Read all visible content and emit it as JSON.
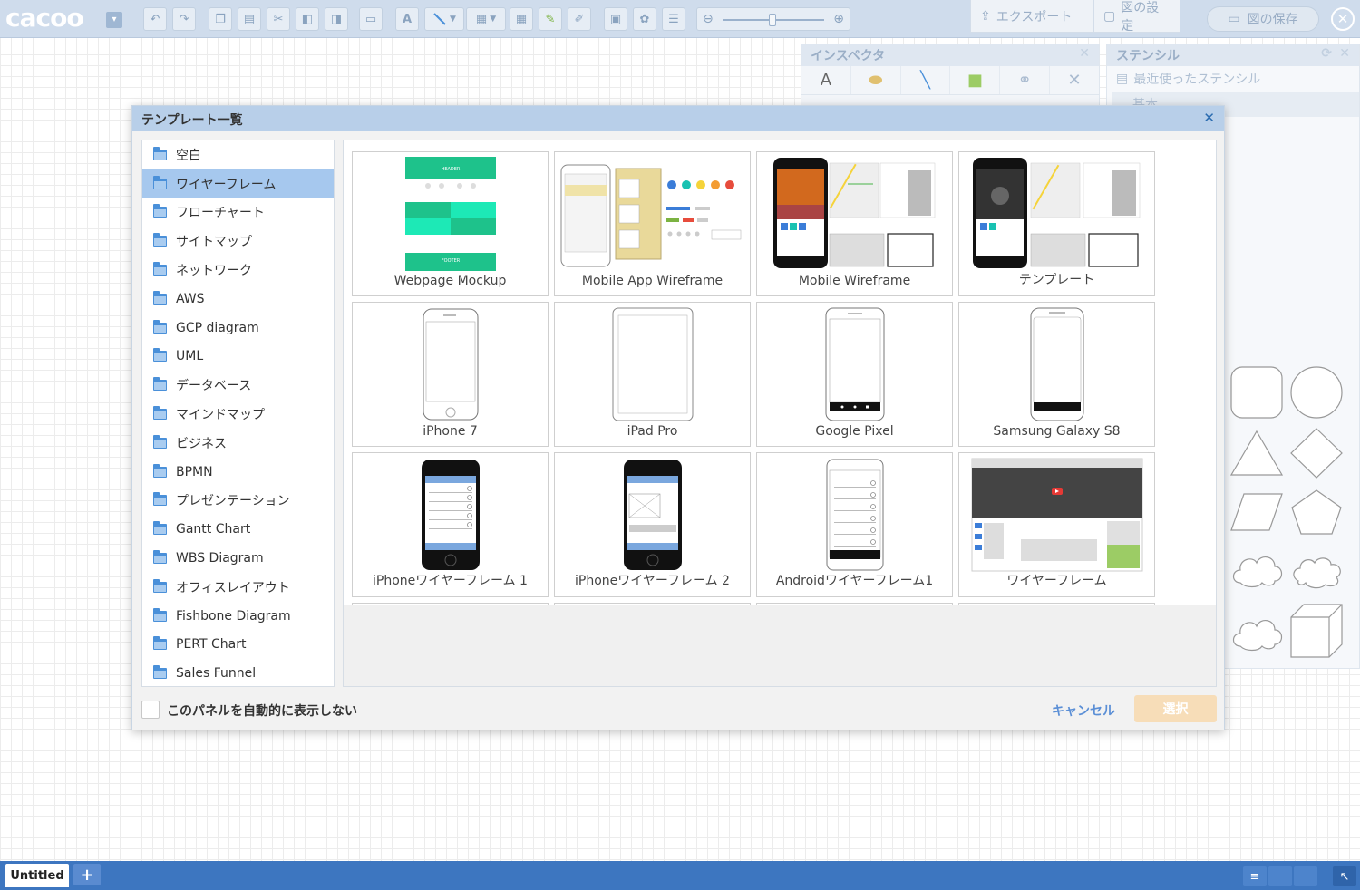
{
  "app": {
    "logo": "cacoo",
    "logo_menu": "▾"
  },
  "toolbar": {
    "export_label": "エクスポート",
    "settings_label": "図の設定",
    "save_label": "図の保存",
    "close_icon": "✕"
  },
  "inspector": {
    "title": "インスペクタ",
    "tab_text": "A"
  },
  "stencil": {
    "title": "ステンシル",
    "recent_label": "最近使ったステンシル",
    "basic_label": "基本"
  },
  "dialog": {
    "title": "テンプレート一覧",
    "categories": [
      {
        "label": "空白"
      },
      {
        "label": "ワイヤーフレーム"
      },
      {
        "label": "フローチャート"
      },
      {
        "label": "サイトマップ"
      },
      {
        "label": "ネットワーク"
      },
      {
        "label": "AWS"
      },
      {
        "label": "GCP diagram"
      },
      {
        "label": "UML"
      },
      {
        "label": "データベース"
      },
      {
        "label": "マインドマップ"
      },
      {
        "label": "ビジネス"
      },
      {
        "label": "BPMN"
      },
      {
        "label": "プレゼンテーション"
      },
      {
        "label": "Gantt Chart"
      },
      {
        "label": "WBS Diagram"
      },
      {
        "label": "オフィスレイアウト"
      },
      {
        "label": "Fishbone Diagram"
      },
      {
        "label": "PERT Chart"
      },
      {
        "label": "Sales Funnel"
      }
    ],
    "selected_category": "ワイヤーフレーム",
    "templates": [
      {
        "label": "Webpage Mockup"
      },
      {
        "label": "Mobile App Wireframe"
      },
      {
        "label": "Mobile Wireframe"
      },
      {
        "label": "テンプレート"
      },
      {
        "label": "iPhone 7"
      },
      {
        "label": "iPad Pro"
      },
      {
        "label": "Google Pixel"
      },
      {
        "label": "Samsung Galaxy S8"
      },
      {
        "label": "iPhoneワイヤーフレーム 1"
      },
      {
        "label": "iPhoneワイヤーフレーム 2"
      },
      {
        "label": "Androidワイヤーフレーム1"
      },
      {
        "label": "ワイヤーフレーム"
      }
    ],
    "thumb_texts": {
      "header": "HEADER",
      "footer": "FOOTER"
    },
    "auto_show_label": "このパネルを自動的に表示しない",
    "cancel_label": "キャンセル",
    "select_label": "選択",
    "close_icon": "✕"
  },
  "bottom": {
    "page_tab": "Untitled",
    "add_page": "+",
    "list_icon": "≡"
  },
  "colors": {
    "topbar": "#cfdcec",
    "dialog_header": "#b8cfe9",
    "selection": "#a6c8ee",
    "bottombar": "#3d76c0",
    "accent": "#4a90d9"
  }
}
